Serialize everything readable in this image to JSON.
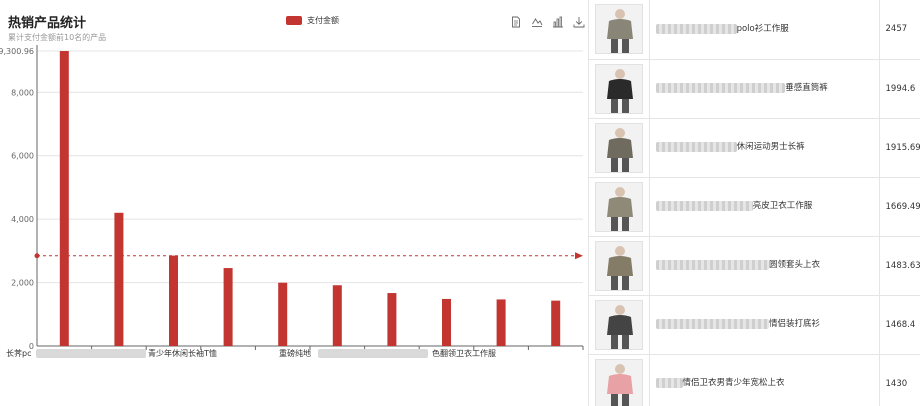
{
  "chart_data": {
    "type": "bar",
    "title": "热销产品统计",
    "subtitle": "累计支付金额前10名的产品",
    "series": [
      {
        "name": "支付金额",
        "values": [
          9300.96,
          4200,
          2850,
          2457,
          1994.6,
          1915.69,
          1669.49,
          1483.63,
          1468.4,
          1430
        ],
        "color": "#c23531"
      }
    ],
    "categories": [
      "长荠pc",
      "",
      "青少年休闲长袖T恤",
      "",
      "重磅纯地",
      "",
      "",
      "色翻领卫衣工作服",
      "",
      ""
    ],
    "y_ticks": [
      "0",
      "2,000",
      "4,000",
      "6,000",
      "8,000"
    ],
    "y_max_label": "9,300.96",
    "ylim": [
      0,
      9300.96
    ],
    "average_line": 2845.38,
    "grid": true,
    "legend_position": "top-center"
  },
  "toolbox": [
    "data-view-icon",
    "line-chart-icon",
    "bar-chart-icon",
    "download-icon"
  ],
  "table": {
    "rows": [
      {
        "name": "polo衫工作服",
        "value": "2457",
        "thumb_color": "#8a8677"
      },
      {
        "name": "垂感直筒裤",
        "value": "1994.6",
        "thumb_color": "#2a2a2a"
      },
      {
        "name": "休闲运动男士长裤",
        "value": "1915.69",
        "thumb_color": "#6f6b5e"
      },
      {
        "name": "亮皮卫衣工作服",
        "value": "1669.49",
        "thumb_color": "#8f8a78"
      },
      {
        "name": "圆领套头上衣",
        "value": "1483.63",
        "thumb_color": "#857c68"
      },
      {
        "name": "情侣装打底衫",
        "value": "1468.4",
        "thumb_color": "#444444"
      },
      {
        "name": "情侣卫衣男青少年宽松上衣",
        "value": "1430",
        "thumb_color": "#e8a2a6"
      }
    ]
  }
}
